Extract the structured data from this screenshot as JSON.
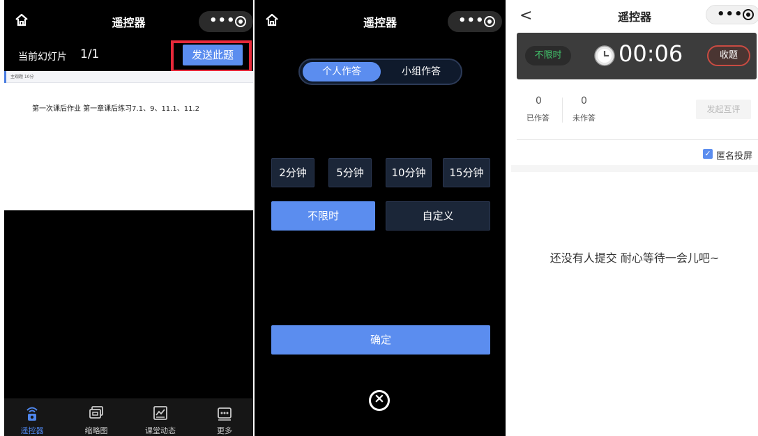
{
  "panels": [
    {
      "nav": {
        "title": "遥控器"
      },
      "slide": {
        "label": "当前幻灯片",
        "count": "1/1",
        "send_label": "发送此题"
      },
      "preview": {
        "tag": "主观题 10分",
        "text": "第一次课后作业 第一章课后练习7.1、9、11.1、11.2"
      },
      "tabbar": [
        {
          "label": "遥控器",
          "icon": "remote-icon",
          "active": true
        },
        {
          "label": "缩略图",
          "icon": "thumbnail-icon",
          "active": false
        },
        {
          "label": "课堂动态",
          "icon": "class-activity-icon",
          "active": false
        },
        {
          "label": "更多",
          "icon": "more-icon",
          "active": false
        }
      ]
    },
    {
      "nav": {
        "title": "遥控器"
      },
      "mode": {
        "individual": "个人作答",
        "group": "小组作答",
        "selected": "个人作答"
      },
      "durations": [
        "2分钟",
        "5分钟",
        "10分钟",
        "15分钟"
      ],
      "limit": {
        "unlimited": "不限时",
        "custom": "自定义",
        "selected": "不限时"
      },
      "confirm": "确定"
    },
    {
      "nav": {
        "title": "遥控器"
      },
      "timer": {
        "mode": "不限时",
        "time": "00:06",
        "collect": "收题"
      },
      "stats": {
        "answered_count": "0",
        "answered_label": "已作答",
        "unanswered_count": "0",
        "unanswered_label": "未作答"
      },
      "peer_review": "发起互评",
      "anonymous": {
        "label": "匿名投屏",
        "checked": true
      },
      "empty_message": "还没有人提交 耐心等待一会儿吧~"
    }
  ],
  "colors": {
    "accent": "#5b8def",
    "highlight_frame": "#e8293a",
    "status_green": "#42c36b",
    "collect_red": "#c94b42"
  }
}
